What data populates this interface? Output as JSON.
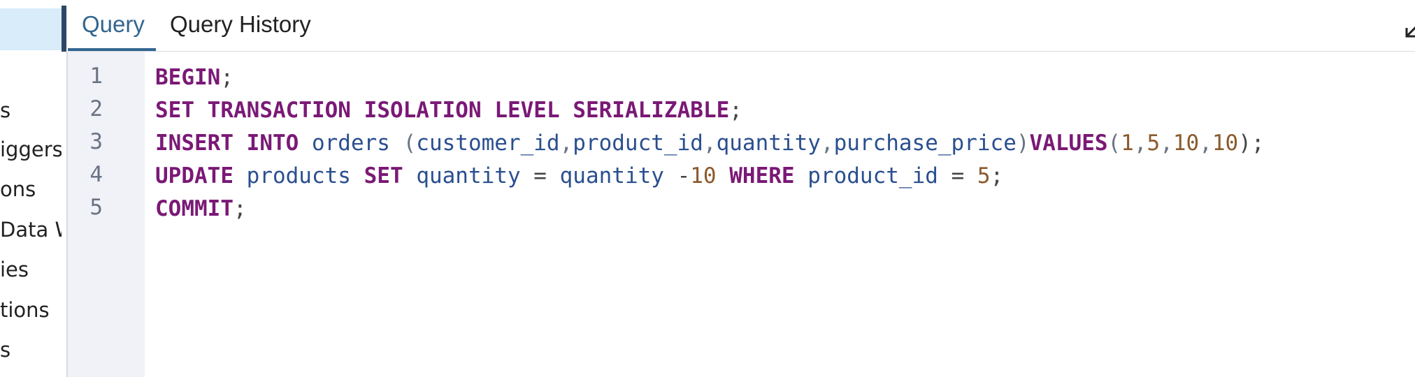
{
  "sidebar": {
    "items": [
      "s",
      "iggers",
      "ons",
      "Data W",
      "ies",
      "tions",
      "s"
    ]
  },
  "tabs": [
    {
      "label": "Query",
      "active": true
    },
    {
      "label": "Query History",
      "active": false
    }
  ],
  "editor": {
    "line_numbers": [
      "1",
      "2",
      "3",
      "4",
      "5"
    ],
    "lines": [
      [
        {
          "t": "BEGIN",
          "c": "kw"
        },
        {
          "t": ";",
          "c": "op"
        }
      ],
      [
        {
          "t": "SET",
          "c": "kw"
        },
        {
          "t": " ",
          "c": "op"
        },
        {
          "t": "TRANSACTION",
          "c": "kw"
        },
        {
          "t": " ",
          "c": "op"
        },
        {
          "t": "ISOLATION",
          "c": "kw"
        },
        {
          "t": " ",
          "c": "op"
        },
        {
          "t": "LEVEL",
          "c": "kw"
        },
        {
          "t": " ",
          "c": "op"
        },
        {
          "t": "SERIALIZABLE",
          "c": "kw"
        },
        {
          "t": ";",
          "c": "op"
        }
      ],
      [
        {
          "t": "INSERT",
          "c": "kw"
        },
        {
          "t": " ",
          "c": "op"
        },
        {
          "t": "INTO",
          "c": "kw"
        },
        {
          "t": " ",
          "c": "op"
        },
        {
          "t": "orders",
          "c": "id"
        },
        {
          "t": " (",
          "c": "pn"
        },
        {
          "t": "customer_id",
          "c": "id"
        },
        {
          "t": ",",
          "c": "pn"
        },
        {
          "t": "product_id",
          "c": "id"
        },
        {
          "t": ",",
          "c": "pn"
        },
        {
          "t": "quantity",
          "c": "id"
        },
        {
          "t": ",",
          "c": "pn"
        },
        {
          "t": "purchase_price",
          "c": "id"
        },
        {
          "t": ")",
          "c": "pn"
        },
        {
          "t": "VALUES",
          "c": "kw"
        },
        {
          "t": "(",
          "c": "pn"
        },
        {
          "t": "1",
          "c": "num"
        },
        {
          "t": ",",
          "c": "pn"
        },
        {
          "t": "5",
          "c": "num"
        },
        {
          "t": ",",
          "c": "pn"
        },
        {
          "t": "10",
          "c": "num"
        },
        {
          "t": ",",
          "c": "pn"
        },
        {
          "t": "10",
          "c": "num"
        },
        {
          "t": ");",
          "c": "op"
        }
      ],
      [
        {
          "t": "UPDATE",
          "c": "kw"
        },
        {
          "t": " ",
          "c": "op"
        },
        {
          "t": "products",
          "c": "id"
        },
        {
          "t": " ",
          "c": "op"
        },
        {
          "t": "SET",
          "c": "kw"
        },
        {
          "t": " ",
          "c": "op"
        },
        {
          "t": "quantity",
          "c": "id"
        },
        {
          "t": " = ",
          "c": "op"
        },
        {
          "t": "quantity",
          "c": "id"
        },
        {
          "t": " -",
          "c": "op"
        },
        {
          "t": "10",
          "c": "num"
        },
        {
          "t": " ",
          "c": "op"
        },
        {
          "t": "WHERE",
          "c": "kw"
        },
        {
          "t": " ",
          "c": "op"
        },
        {
          "t": "product_id",
          "c": "id"
        },
        {
          "t": " = ",
          "c": "op"
        },
        {
          "t": "5",
          "c": "num"
        },
        {
          "t": ";",
          "c": "op"
        }
      ],
      [
        {
          "t": "COMMIT",
          "c": "kw"
        },
        {
          "t": ";",
          "c": "op"
        }
      ]
    ]
  },
  "icons": {
    "expand": "collapse-arrow-icon"
  },
  "colors": {
    "keyword": "#7a1976",
    "identifier": "#2a4f8f",
    "number": "#8a5a2c",
    "active_tab": "#326690",
    "gutter_bg": "#f0f2f7",
    "selected_row": "#d8ecfa"
  }
}
